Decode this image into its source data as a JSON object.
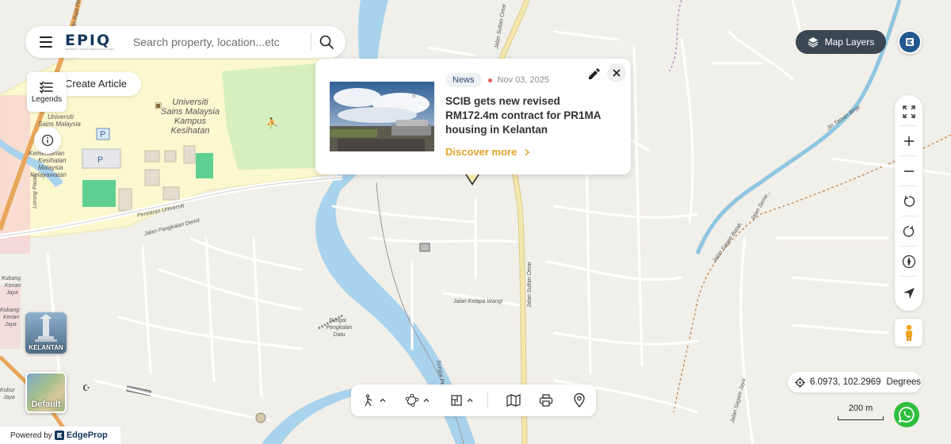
{
  "header": {
    "logo_text": "EPIQ",
    "logo_tagline": "PROPERTY INTELLIGENCE PLATFORM",
    "search_placeholder": "Search property, location...etc"
  },
  "left_controls": {
    "create_article_label": "Create Article",
    "legends_label": "Legends",
    "region_label": "KELANTAN",
    "basemap_label": "Default",
    "powered_by_text": "Powered by",
    "powered_by_brand": "EdgeProp"
  },
  "popup": {
    "category": "News",
    "date": "Nov 03, 2025",
    "headline": "SCIB gets new revised RM172.4m contract for PR1MA housing in Kelantan",
    "link_label": "Discover more",
    "image_watermark": "ⓔ"
  },
  "right_controls": {
    "map_layers_label": "Map Layers",
    "tools": [
      "fullscreen-icon",
      "zoom-in-icon",
      "zoom-out-icon",
      "rotate-left-icon",
      "rotate-right-icon",
      "compass-icon",
      "locate-icon"
    ],
    "coordinates": "6.0973, 102.2969",
    "coordinate_unit": "Degrees",
    "scale_label": "200 m"
  },
  "bottom_toolbar": {
    "tools": [
      "measure-icon",
      "draw-shape-icon",
      "plan-icon",
      "map-view-icon",
      "print-icon",
      "pin-icon"
    ]
  },
  "map_labels": {
    "university": [
      "Universiti",
      "Sains Malaysia",
      "Kampus",
      "Kesihatan"
    ],
    "university_small": [
      "Universiti",
      "Sains Malaysia"
    ],
    "kementerian": [
      "Kementerian",
      "Kesihatan",
      "Malaysia",
      "Kelayawatan"
    ],
    "persiaran": "Persiaran Universiti",
    "pangkalan_road": "Jalan Pangkalan Demit",
    "kelapa_wangi": "Jalan Kelapa Wangi",
    "sultan_omar_top": "Jalan Sultan Omar",
    "sultan_omar_mid": "Jalan Sultan Omar",
    "sungai": [
      "Sungai",
      "Pengkalan",
      "Datu"
    ],
    "sungai_e": "Sungai Pe...",
    "lorong": "Lorong Pasah",
    "jin_raja": "Jln Raja Per...",
    "taman_binje": "Jln Taman Binje",
    "sagae": "Jalan Sagae Batah",
    "seme": "Jalan Seme...",
    "sagae2": "Jalan Sagae Batah",
    "sagae_bottom": "Jalan Sagam Jaya",
    "kubang": [
      "Kubang",
      "Kerian",
      "Jaya"
    ],
    "kubang2": [
      "Kubang",
      "Kerian",
      "Jaya"
    ],
    "kubur": [
      "Kubur",
      "Jaya"
    ]
  },
  "colors": {
    "brand_navy": "#14365e",
    "accent_gold": "#e2a02a",
    "map_bg": "#f1efe9",
    "river": "#a9d2ec",
    "campus": "#fbf7cf",
    "park": "#d7efc0",
    "main_road": "#f4e7ad",
    "whatsapp_green": "#2fbe3e"
  }
}
